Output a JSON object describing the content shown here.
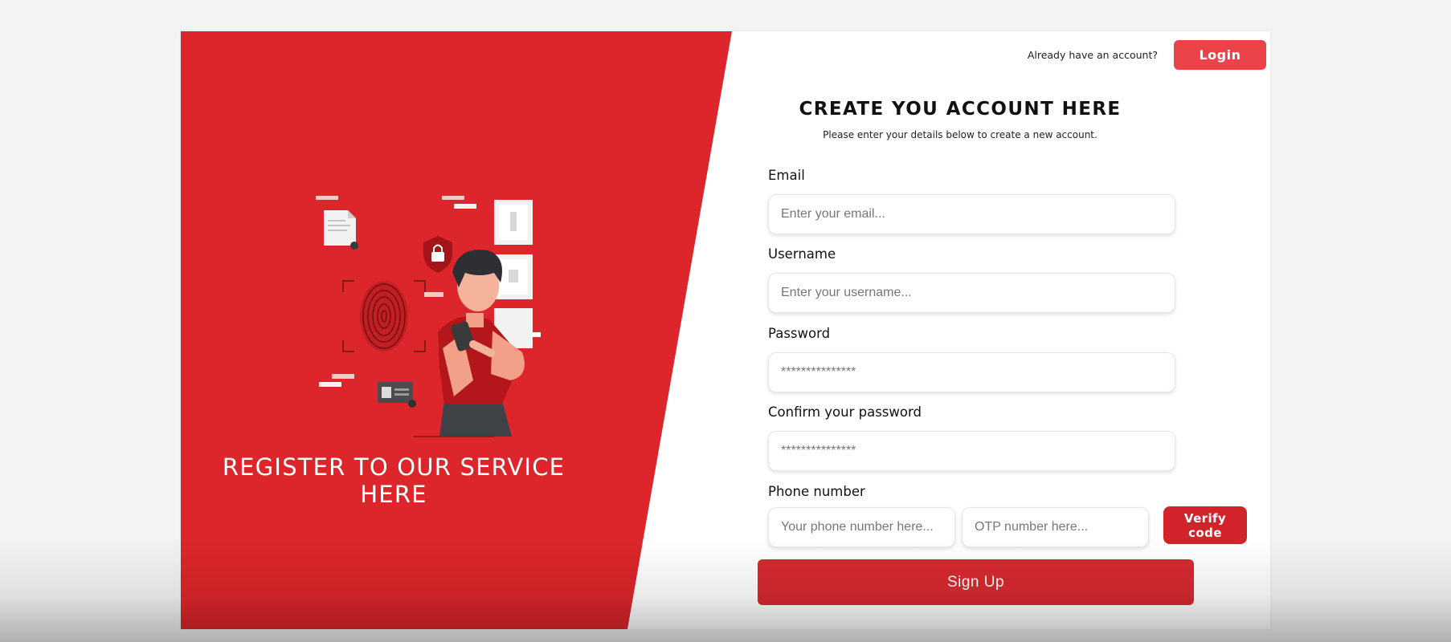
{
  "left_panel": {
    "title": "REGISTER TO OUR SERVICE HERE",
    "illustration": "person-fingerprint-security-illustration"
  },
  "header": {
    "account_prompt": "Already have an account?",
    "login_label": "Login"
  },
  "form": {
    "title": "CREATE YOU ACCOUNT HERE",
    "subtitle": "Please enter your details below to create a new account.",
    "email": {
      "label": "Email",
      "placeholder": "Enter your email..."
    },
    "username": {
      "label": "Username",
      "placeholder": "Enter your username..."
    },
    "password": {
      "label": "Password",
      "placeholder": "***************"
    },
    "confirm_password": {
      "label": "Confirm your password",
      "placeholder": "***************"
    },
    "phone": {
      "label": "Phone number",
      "placeholder": "Your phone number here...",
      "otp_placeholder": "OTP number here...",
      "verify_label": "Verify code"
    },
    "signup_label": "Sign Up"
  },
  "colors": {
    "accent_red": "#dc262b",
    "login_button": "#ea4348",
    "signup_button": "#d72a30"
  }
}
